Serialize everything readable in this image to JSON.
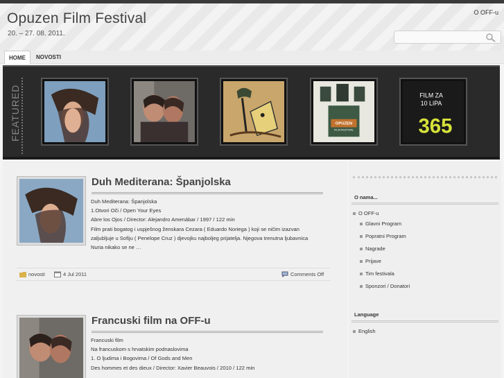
{
  "site": {
    "title": "Opuzen Film Festival",
    "description": "20. – 27. 08. 2011.",
    "top_link": "O OFF-u"
  },
  "search": {
    "placeholder": ""
  },
  "nav": {
    "items": [
      "HOME",
      "NOVOSTI"
    ]
  },
  "featured": {
    "label": "FEATURED",
    "thumbs": [
      "woman-hair-portrait",
      "couple-embrace",
      "animated-characters",
      "opuzen-film-festival-poster",
      "film-za-10-lipa-365"
    ],
    "poster_text": {
      "line1": "FILM ZA",
      "line2": "10 LIPA",
      "num": "365",
      "opuzen": "OPUZEN",
      "ff": "FILM FESTIVAL"
    }
  },
  "posts": [
    {
      "title": "Duh Mediterana: Španjolska",
      "body": [
        "Duh Mediterana: Španjolska",
        "1.Otvori Oči / Open Your Eyes",
        "Abre los Ojos / Director: Alejandro Amenábar / 1997 / 122 min",
        "Film prati bogatog i uspješnog ženskara Cezara ( Eduardo Noriega ) koji se ničim izazvan",
        "zaljubljuje u Sofiju ( Penelope Cruz ) djevojku najboljeg prijatelja. Njegova trenutna ljubavnica",
        "Nuria nikako se ne …"
      ],
      "category": "novosti",
      "date": "4 Jul 2011",
      "comments": "Comments Off"
    },
    {
      "title": "Francuski film na OFF-u",
      "body": [
        "Francuski film",
        "Na francuskom s hrvatskim podnaslovima",
        "1. O ljudima i Bogovima / Of Gods and Men",
        "Des hommes et des dieux / Director: Xavier Beauvois / 2010 / 122 min"
      ]
    }
  ],
  "sidebar": {
    "about_title": "O nama...",
    "about_items": [
      "O OFF-u"
    ],
    "sub_items": [
      "Glavni Program",
      "Popratni Program",
      "Nagrade",
      "Prijave",
      "Tim festivala",
      "Sponzori / Donatori"
    ],
    "language_title": "Language",
    "language_items": [
      "English"
    ]
  },
  "colors": {
    "featured_bg": "#2a2a2a",
    "topbar": "#3a3a3a",
    "text": "#333333"
  }
}
